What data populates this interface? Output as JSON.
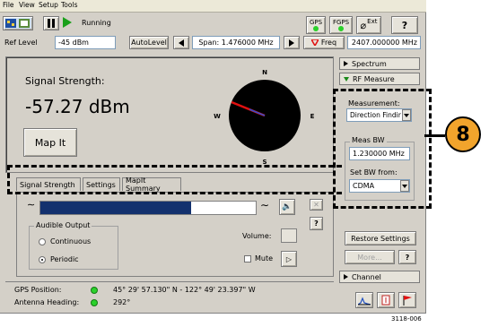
{
  "menu": [
    "File",
    "View",
    "Setup",
    "Tools"
  ],
  "toolbar": {
    "status": "Running",
    "gps": "GPS",
    "fgps": "FGPS",
    "ext": "Ext",
    "help": "?"
  },
  "controls": {
    "ref_level_label": "Ref Level",
    "ref_level_value": "-45 dBm",
    "autolevel": "AutoLevel",
    "span": "Span: 1.476000 MHz",
    "freq_label": "Freq",
    "freq_value": "2407.000000 MHz"
  },
  "signal": {
    "label": "Signal Strength:",
    "value": "-57.27 dBm",
    "map_button": "Map It"
  },
  "compass": {
    "n": "N",
    "s": "S",
    "e": "E",
    "w": "W",
    "heading_deg": 292
  },
  "tabs": [
    "Signal Strength",
    "Settings",
    "MapIt Summary"
  ],
  "audio": {
    "group_label": "Audible Output",
    "options": [
      "Continuous",
      "Periodic"
    ],
    "selected": "Periodic",
    "volume": "Volume:",
    "mute": "Mute",
    "level_fraction": 0.7
  },
  "side": {
    "spectrum": "Spectrum",
    "rf_measure": "RF Measure",
    "measurement_label": "Measurement:",
    "measurement_value": "Direction Findir",
    "meas_bw_label": "Meas BW",
    "meas_bw_value": "1.230000 MHz",
    "set_bw_label": "Set BW from:",
    "set_bw_value": "CDMA",
    "restore": "Restore Settings",
    "more": "More...",
    "help": "?",
    "channel": "Channel"
  },
  "status": {
    "gps_label": "GPS Position:",
    "gps_value": "45° 29' 57.130\" N - 122° 49' 23.397\" W",
    "heading_label": "Antenna Heading:",
    "heading_value": "292°"
  },
  "callout": "8",
  "figure_id": "3118-006",
  "colors": {
    "callout_fill": "#f2a42c",
    "meter_fill": "#13316e",
    "needle": "#e01010"
  }
}
